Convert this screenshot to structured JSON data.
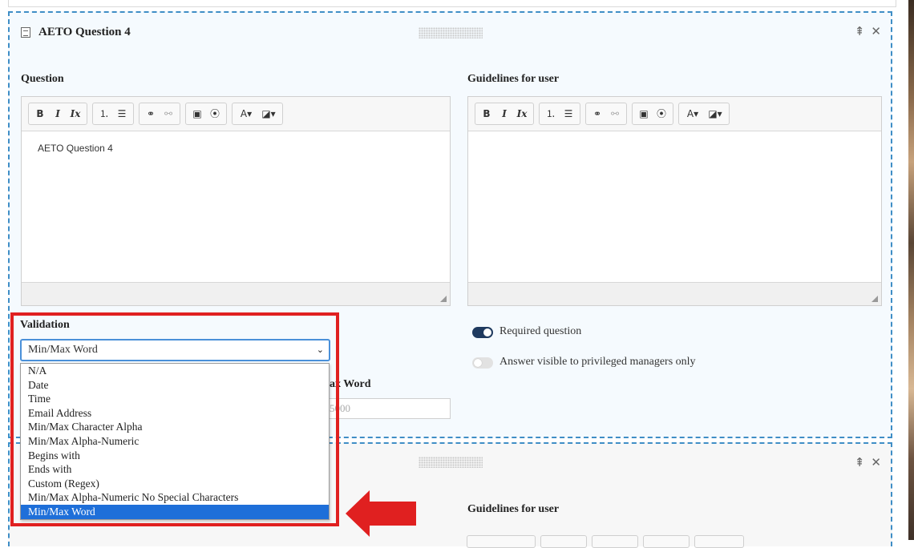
{
  "panel": {
    "title": "AETO Question 4",
    "question_label": "Question",
    "guidelines_label": "Guidelines for user",
    "question_text": "AETO Question 4",
    "guidelines_text": ""
  },
  "toolbar": {
    "bold": "B",
    "italic": "I",
    "clear": "Ix",
    "ordered": "⒈",
    "bulleted": "☰",
    "link": "⚭",
    "unlink": "⚯",
    "image": "▣",
    "media": "⦿",
    "text_color": "A▾",
    "bg_color": "◪▾"
  },
  "validation": {
    "label": "Validation",
    "selected": "Min/Max Word",
    "options": [
      "N/A",
      "Date",
      "Time",
      "Email Address",
      "Min/Max Character Alpha",
      "Min/Max Alpha-Numeric",
      "Begins with",
      "Ends with",
      "Custom (Regex)",
      "Min/Max Alpha-Numeric No Special Characters",
      "Min/Max Word"
    ],
    "behind_label_partial": "ax Word",
    "behind_value_partial": "5000"
  },
  "toggles": {
    "required": {
      "label": "Required question",
      "on": true
    },
    "privileged": {
      "label": "Answer visible to privileged managers only",
      "on": false
    }
  },
  "panel2": {
    "guidelines_label": "Guidelines for user"
  },
  "icons": {
    "collapse": "⇞",
    "close": "✕"
  },
  "colors": {
    "accent": "#3f8ec6",
    "highlight": "#e02020",
    "selected_option": "#1e6fd9",
    "toggle_on": "#1f3a5f"
  }
}
